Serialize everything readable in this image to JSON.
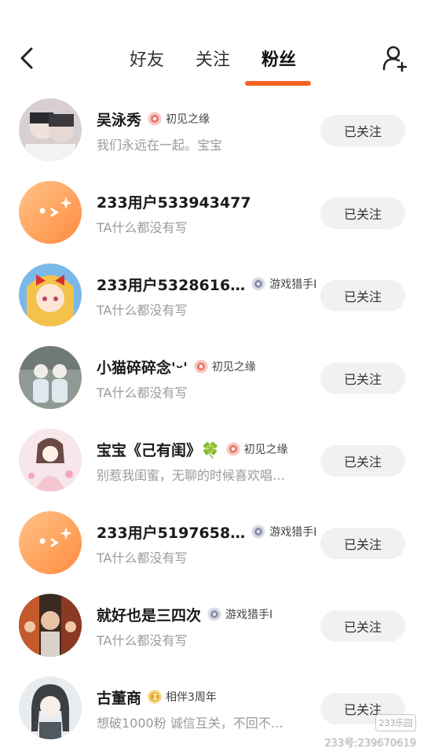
{
  "header": {
    "tabs": [
      {
        "label": "好友",
        "active": false
      },
      {
        "label": "关注",
        "active": false
      },
      {
        "label": "粉丝",
        "active": true
      }
    ],
    "accent_color": "#f4631f"
  },
  "fans": [
    {
      "name": "吴泳秀",
      "badge": "初见之缘",
      "badge_icon": "first-meet-badge-icon",
      "bio": "我们永远在一起。宝宝",
      "button": "已关注"
    },
    {
      "name": "233用户533943477",
      "badge": "",
      "badge_icon": "",
      "bio": "TA什么都没有写",
      "button": "已关注"
    },
    {
      "name": "233用户5328616…",
      "badge": "游戏猎手I",
      "badge_icon": "game-hunter-badge-icon",
      "bio": "TA什么都没有写",
      "button": "已关注"
    },
    {
      "name": "小猫碎碎念'ᵕ'",
      "badge": "初见之缘",
      "badge_icon": "first-meet-badge-icon",
      "bio": "TA什么都没有写",
      "button": "已关注"
    },
    {
      "name": "宝宝《己有闺》🍀",
      "badge": "初见之缘",
      "badge_icon": "first-meet-badge-icon",
      "bio": "别惹我闺蜜，无聊的时候喜欢唱…",
      "button": "已关注"
    },
    {
      "name": "233用户5197658…",
      "badge": "游戏猎手I",
      "badge_icon": "game-hunter-badge-icon",
      "bio": "TA什么都没有写",
      "button": "已关注"
    },
    {
      "name": "就好也是三四次",
      "badge": "游戏猎手I",
      "badge_icon": "game-hunter-badge-icon",
      "bio": "TA什么都没有写",
      "button": "已关注"
    },
    {
      "name": "古董商",
      "badge": "相伴3周年",
      "badge_icon": "anniversary-badge-icon",
      "bio": "想破1000粉 诚信互关，不回不…",
      "button": "已关注"
    }
  ],
  "watermark": {
    "logo": "233乐园",
    "id": "233号:239670619"
  }
}
